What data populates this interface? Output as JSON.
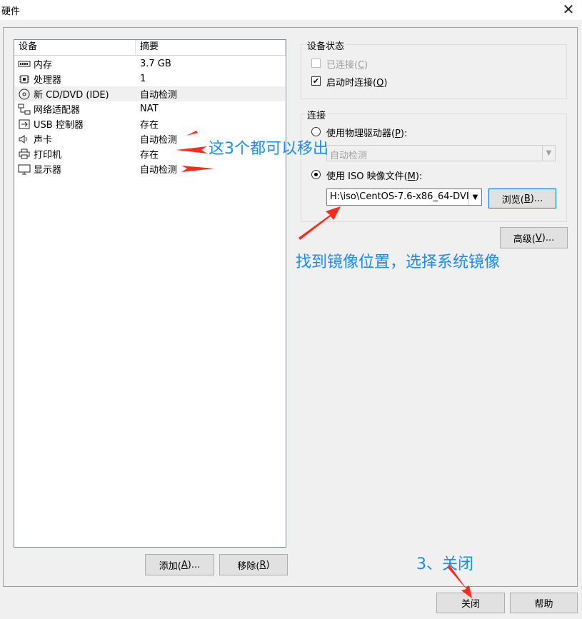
{
  "window": {
    "title": "硬件"
  },
  "device_list": {
    "headers": {
      "device": "设备",
      "summary": "摘要"
    },
    "rows": [
      {
        "name": "内存",
        "summary": "3.7 GB",
        "icon": "memory-icon"
      },
      {
        "name": "处理器",
        "summary": "1",
        "icon": "cpu-icon"
      },
      {
        "name": "新 CD/DVD (IDE)",
        "summary": "自动检测",
        "icon": "cd-dvd-icon",
        "selected": true
      },
      {
        "name": "网络适配器",
        "summary": "NAT",
        "icon": "network-adapter-icon"
      },
      {
        "name": "USB 控制器",
        "summary": "存在",
        "icon": "usb-icon"
      },
      {
        "name": "声卡",
        "summary": "自动检测",
        "icon": "speaker-icon"
      },
      {
        "name": "打印机",
        "summary": "存在",
        "icon": "printer-icon"
      },
      {
        "name": "显示器",
        "summary": "自动检测",
        "icon": "monitor-icon"
      }
    ],
    "add_button": {
      "label": "添加(",
      "key": "A",
      "suffix": ")..."
    },
    "remove_button": {
      "label": "移除(",
      "key": "R",
      "suffix": ")"
    }
  },
  "device_status": {
    "title": "设备状态",
    "connected": {
      "label": "已连接(",
      "key": "C",
      "suffix": ")",
      "checked": false,
      "enabled": false
    },
    "connect_at_power_on": {
      "label": "启动时连接(",
      "key": "O",
      "suffix": ")",
      "checked": true
    }
  },
  "connection": {
    "title": "连接",
    "physical_drive": {
      "label": "使用物理驱动器(",
      "key": "P",
      "suffix": "):",
      "selected": false,
      "value": "自动检测"
    },
    "iso_file": {
      "label": "使用 ISO 映像文件(",
      "key": "M",
      "suffix": "):",
      "selected": true,
      "value": "H:\\iso\\CentOS-7.6-x86_64-DVI"
    },
    "browse_button": {
      "label": "浏览(",
      "key": "B",
      "suffix": ")..."
    }
  },
  "advanced_button": {
    "label": "高级(",
    "key": "V",
    "suffix": ")..."
  },
  "footer": {
    "close_label": "关闭",
    "help_label": "帮助"
  },
  "annotations": {
    "remove_hint": "这3个都可以移出",
    "iso_hint": "找到镜像位置，选择系统镜像",
    "close_hint": "3、关闭",
    "color": "#1a8cff",
    "arrow_color": "#ff2a1a"
  }
}
